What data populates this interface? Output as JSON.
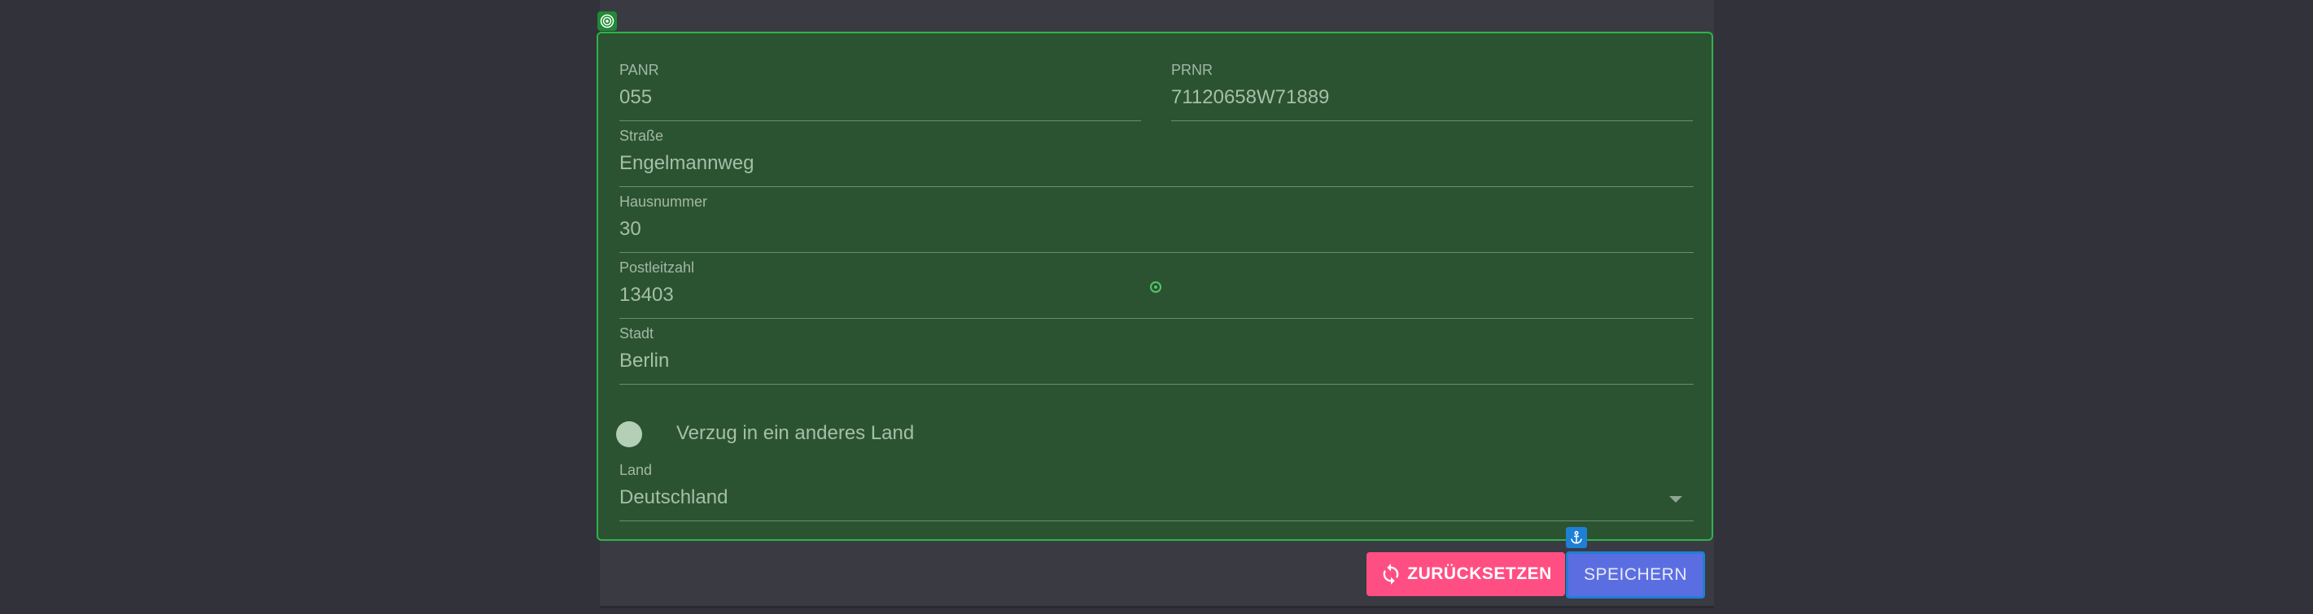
{
  "form": {
    "panr": {
      "label": "PANR",
      "value": "055"
    },
    "prnr": {
      "label": "PRNR",
      "value": "71120658W71889"
    },
    "strasse": {
      "label": "Straße",
      "value": "Engelmannweg"
    },
    "hausnummer": {
      "label": "Hausnummer",
      "value": "30"
    },
    "postleitzahl": {
      "label": "Postleitzahl",
      "value": "13403"
    },
    "stadt": {
      "label": "Stadt",
      "value": "Berlin"
    },
    "toggle": {
      "label": "Verzug in ein anderes Land",
      "checked": false
    },
    "land": {
      "label": "Land",
      "value": "Deutschland"
    }
  },
  "actions": {
    "reset_label": "ZURÜCKSETZEN",
    "save_label": "SPEICHERN"
  },
  "colors": {
    "background": "#32323b",
    "panel": "#2b5331",
    "panel_border": "#2fb34a",
    "reset_button": "#ff4f82",
    "save_button": "#5b6ee1",
    "anchor_badge": "#1e7fd6"
  },
  "icons": {
    "panel_badge": "target-icon",
    "reset": "refresh-icon",
    "save_badge": "anchor-icon",
    "land_dropdown": "chevron-down-icon"
  }
}
